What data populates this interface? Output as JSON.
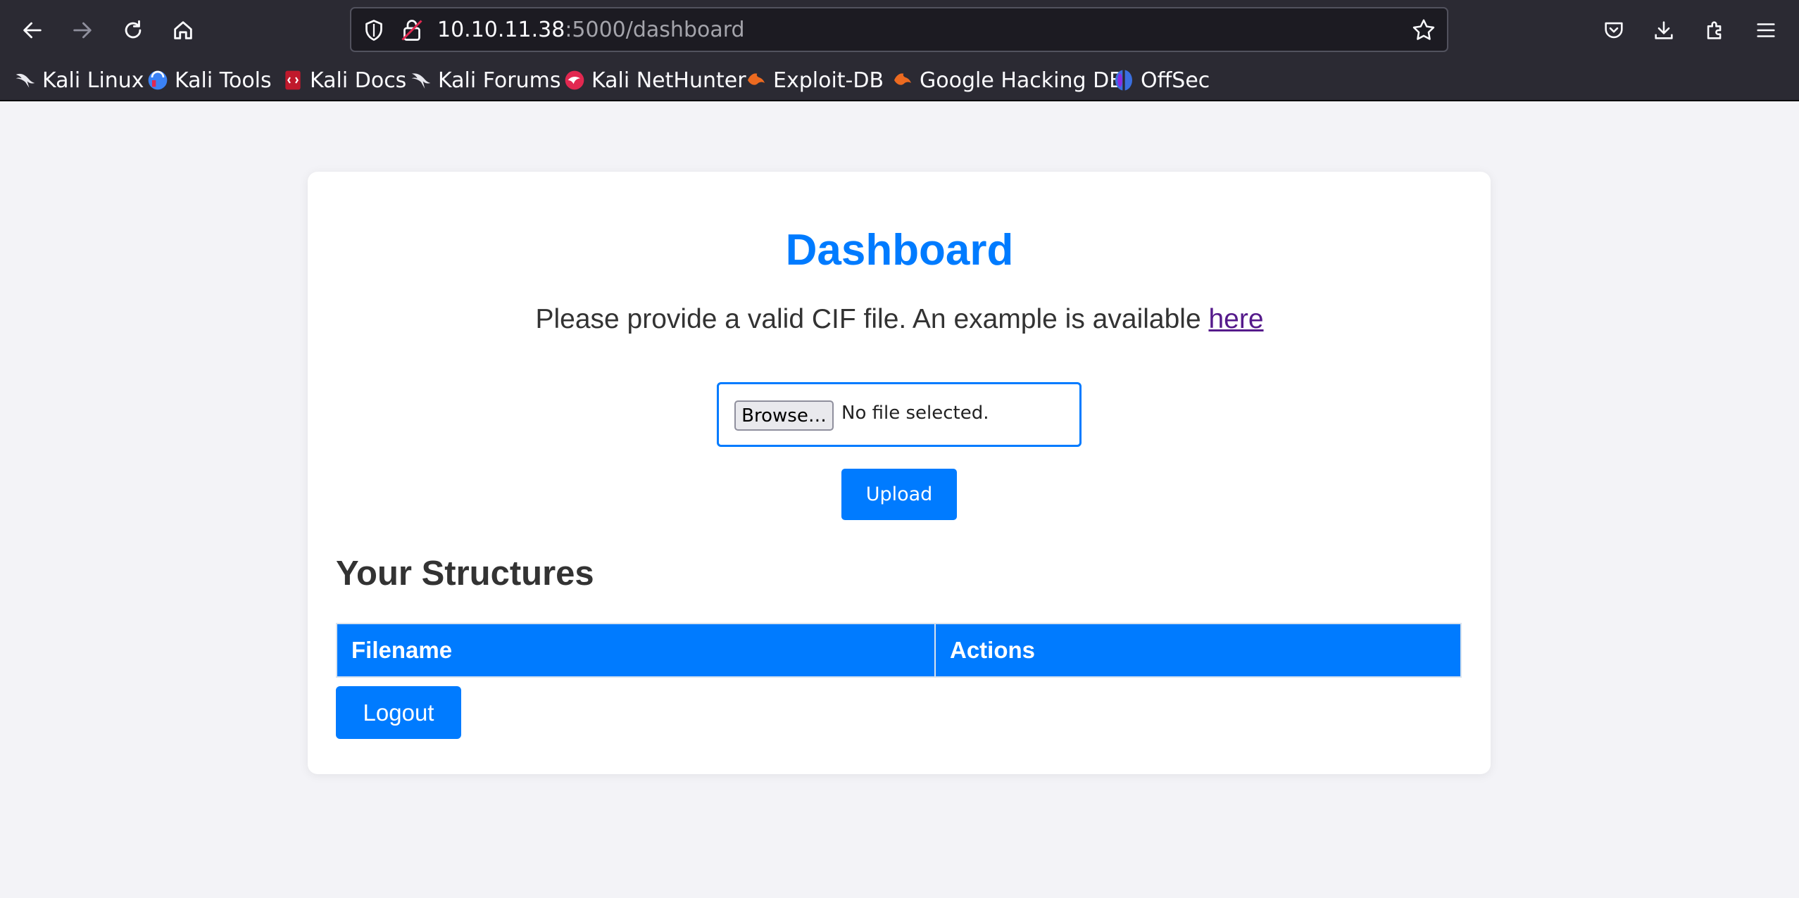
{
  "browser": {
    "url_host": "10.10.11.38",
    "url_rest": ":5000/dashboard"
  },
  "bookmarks": [
    {
      "label": "Kali Linux",
      "icon": "kali-dragon-icon"
    },
    {
      "label": "Kali Tools",
      "icon": "kali-tools-icon"
    },
    {
      "label": "Kali Docs",
      "icon": "kali-docs-icon"
    },
    {
      "label": "Kali Forums",
      "icon": "kali-forums-icon"
    },
    {
      "label": "Kali NetHunter",
      "icon": "kali-nethunter-icon"
    },
    {
      "label": "Exploit-DB",
      "icon": "exploit-db-icon"
    },
    {
      "label": "Google Hacking DB",
      "icon": "ghdb-icon"
    },
    {
      "label": "OffSec",
      "icon": "offsec-icon"
    }
  ],
  "page": {
    "title": "Dashboard",
    "instructions": "Please provide a valid CIF file. An example is available ",
    "example_link": "here",
    "file_input": {
      "button_label": "Browse…",
      "status": "No file selected."
    },
    "upload_label": "Upload",
    "section_title": "Your Structures",
    "table": {
      "columns": [
        "Filename",
        "Actions"
      ],
      "rows": []
    },
    "logout_label": "Logout"
  },
  "colors": {
    "accent": "#007bff",
    "link_visited": "#551a8b",
    "chrome_bg": "#2b2a33",
    "page_bg": "#f3f3f7"
  }
}
